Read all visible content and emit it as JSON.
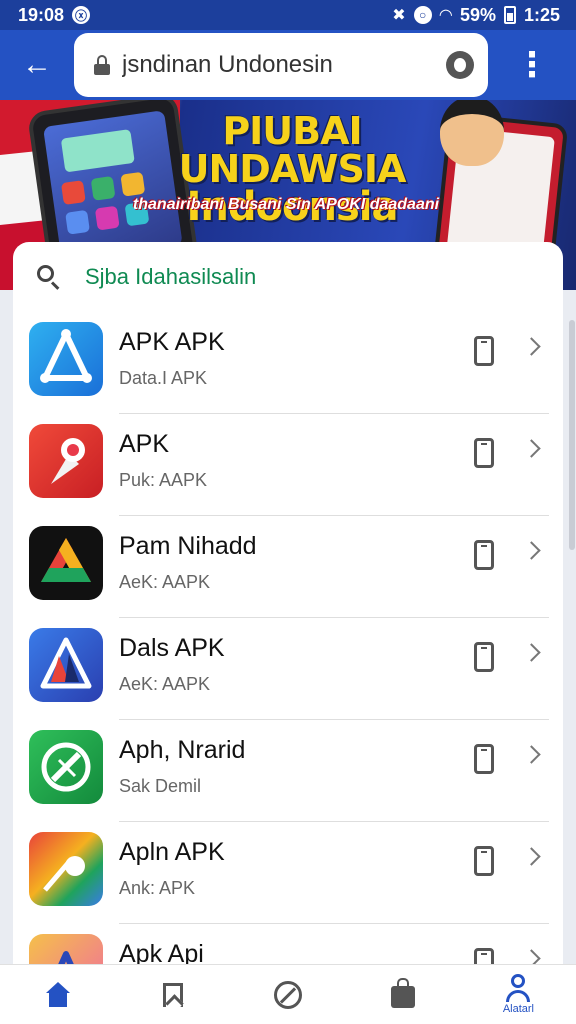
{
  "status_bar": {
    "time": "19:08",
    "left_badge": "ⓧ",
    "battery_percent": "59%",
    "right_time": "1:25"
  },
  "app_bar": {
    "back_glyph": "←",
    "url": "jsndinan Undonesin",
    "menu_glyph": "⋮"
  },
  "banner": {
    "title_line1": "PIUBAI UNDAWSIA",
    "title_line2": "Indoonsia",
    "subtitle": "thanairibani Busani Sin APOKI daadaani"
  },
  "search": {
    "text": "Sjba Idahasilsalin"
  },
  "apps": [
    {
      "name": "APK APK",
      "sub": "Data.I APK",
      "icon": "triangle-app-icon"
    },
    {
      "name": "APK",
      "sub": "Puk: AAPK",
      "icon": "ice-cream-app-icon"
    },
    {
      "name": "Pam Nihadd",
      "sub": "AeK: AAPK",
      "icon": "drive-app-icon"
    },
    {
      "name": "Dals APK",
      "sub": "AeK: AAPK",
      "icon": "prism-app-icon"
    },
    {
      "name": "Aph, Nrarid",
      "sub": "Sak Demil",
      "icon": "compass-app-icon"
    },
    {
      "name": "Apln APK",
      "sub": "Ank: APK",
      "icon": "color-app-icon"
    },
    {
      "name": "Apk Api",
      "sub": "",
      "icon": "letter-app-icon"
    }
  ],
  "bottom_nav": {
    "items": [
      {
        "icon": "home-icon",
        "label": ""
      },
      {
        "icon": "bookmark-icon",
        "label": ""
      },
      {
        "icon": "compass-icon",
        "label": ""
      },
      {
        "icon": "bag-icon",
        "label": ""
      },
      {
        "icon": "user-icon",
        "label": "Alatarl"
      }
    ]
  },
  "colors": {
    "primary": "#2452c3",
    "status_bar": "#1c3f9c",
    "banner_title": "#f7d21b",
    "search_text": "#0f8a52"
  }
}
